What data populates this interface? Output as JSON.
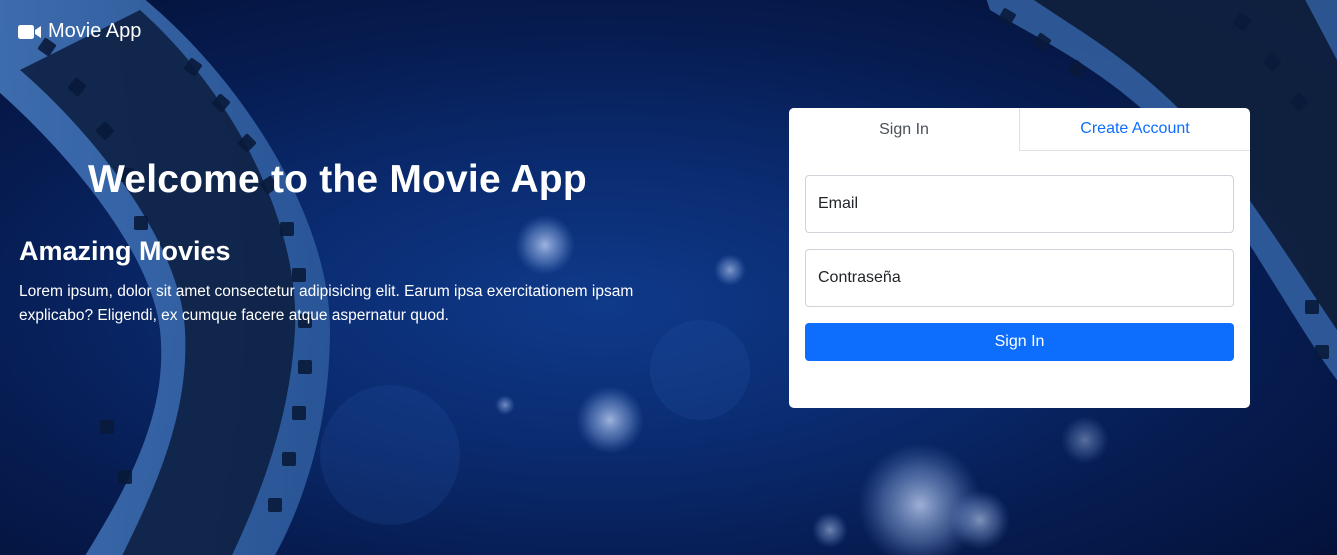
{
  "app": {
    "brand_icon": "video-camera-icon",
    "brand_name": "Movie App"
  },
  "hero": {
    "title": "Welcome to the Movie App",
    "subtitle": "Amazing Movies",
    "body": "Lorem ipsum, dolor sit amet consectetur adipisicing elit. Earum ipsa exercitationem ipsam explicabo? Eligendi, ex cumque facere atque aspernatur quod."
  },
  "auth": {
    "tabs": [
      {
        "label": "Sign In",
        "active": true
      },
      {
        "label": "Create Account",
        "active": false
      }
    ],
    "email_placeholder": "Email",
    "password_placeholder": "Contraseña",
    "submit_label": "Sign In"
  },
  "colors": {
    "primary": "#0d6efd",
    "background": "#0a2a6e",
    "card": "#ffffff"
  }
}
